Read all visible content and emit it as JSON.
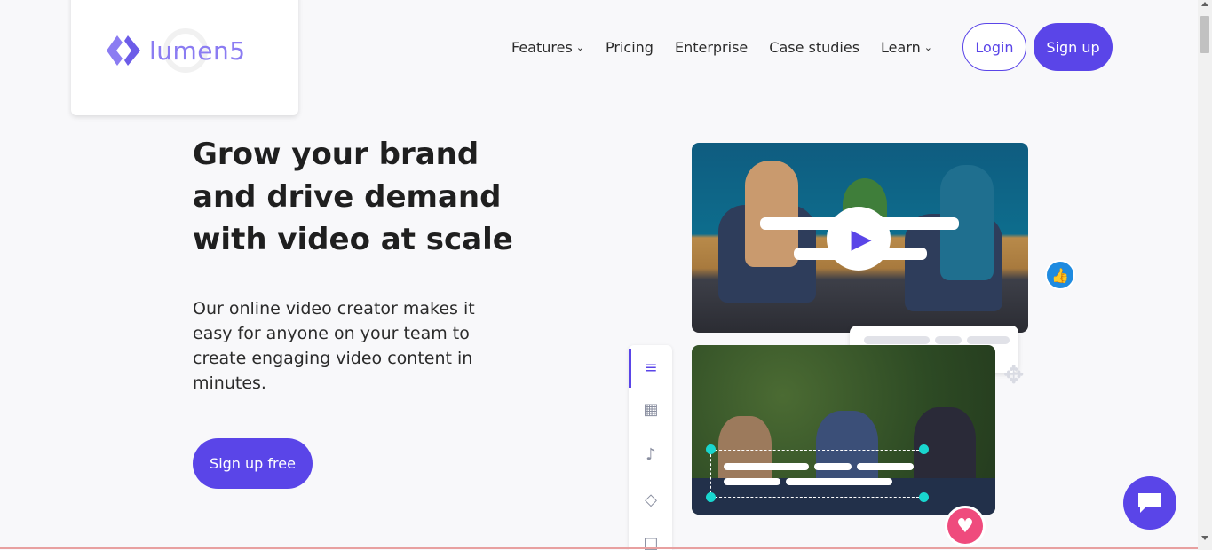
{
  "brand": {
    "name": "lumen5",
    "color": "#8b7cf2"
  },
  "nav": {
    "items": [
      {
        "label": "Features",
        "has_dropdown": true
      },
      {
        "label": "Pricing",
        "has_dropdown": false
      },
      {
        "label": "Enterprise",
        "has_dropdown": false
      },
      {
        "label": "Case studies",
        "has_dropdown": false
      },
      {
        "label": "Learn",
        "has_dropdown": true
      }
    ],
    "login_label": "Login",
    "signup_label": "Sign up"
  },
  "hero": {
    "title": "Grow your brand and drive demand with video at scale",
    "subtitle": "Our online video creator makes it easy for anyone on your team to create engaging video content in minutes.",
    "cta_label": "Sign up free"
  },
  "editor": {
    "tools": [
      "text-tool-icon",
      "image-tool-icon",
      "music-tool-icon",
      "style-tool-icon",
      "format-tool-icon"
    ],
    "active_tool": "text-tool-icon"
  },
  "colors": {
    "accent": "#5a45e8",
    "like": "#1f8be0",
    "heart": "#ef4b7d",
    "selection": "#19d6cf"
  }
}
